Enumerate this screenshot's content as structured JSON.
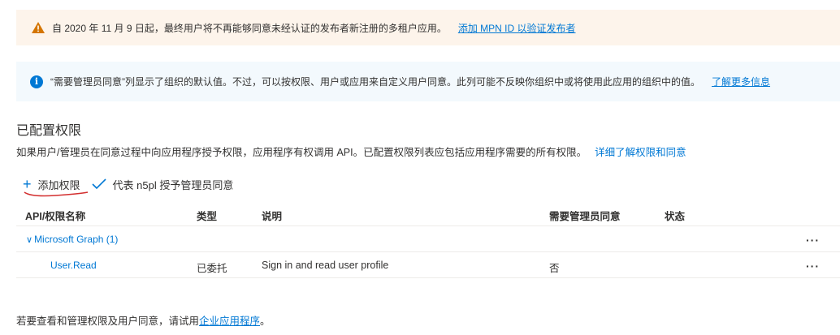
{
  "warning": {
    "message": "自 2020 年 11 月 9 日起，最终用户将不再能够同意未经认证的发布者新注册的多租户应用。",
    "link": "添加 MPN ID 以验证发布者"
  },
  "info": {
    "message": "“需要管理员同意”列显示了组织的默认值。不过，可以按权限、用户或应用来自定义用户同意。此列可能不反映你组织中或将使用此应用的组织中的值。",
    "link": "了解更多信息"
  },
  "section": {
    "title": "已配置权限",
    "description": "如果用户/管理员在同意过程中向应用程序授予权限，应用程序有权调用 API。已配置权限列表应包括应用程序需要的所有权限。",
    "link": "详细了解权限和同意"
  },
  "toolbar": {
    "add_icon": "plus-icon",
    "add_label": "添加权限",
    "grant_icon": "checkmark-icon",
    "grant_label": "代表 n5pl 授予管理员同意"
  },
  "table": {
    "headers": {
      "name": "API/权限名称",
      "type": "类型",
      "description": "说明",
      "admin_consent": "需要管理员同意",
      "status": "状态"
    },
    "group": {
      "name": "Microsoft Graph (1)",
      "more": "···"
    },
    "rows": [
      {
        "name": "User.Read",
        "type": "已委托",
        "description": "Sign in and read user profile",
        "admin_consent": "否",
        "status": "",
        "more": "···"
      }
    ]
  },
  "footer": {
    "text": "若要查看和管理权限及用户同意，请试用",
    "link": "企业应用程序",
    "suffix": "。"
  },
  "colors": {
    "accent": "#0078d4",
    "warning_bg": "#fdf4eb",
    "info_bg": "#f3f9fd",
    "annotation": "#d32f2f"
  }
}
